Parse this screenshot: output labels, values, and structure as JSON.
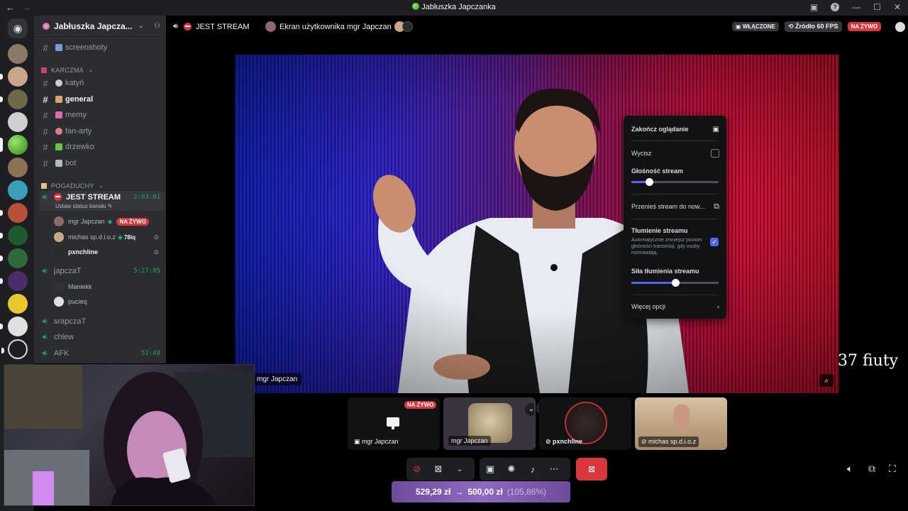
{
  "window": {
    "title": "Jabłuszka Japczanka"
  },
  "server": {
    "name": "Jabłuszka Japcza..."
  },
  "channels_top": [
    {
      "name": "screenshoty"
    }
  ],
  "categories": {
    "karczma": "KARCZMA",
    "pogaduchy": "POGADUCHY"
  },
  "channels_karczma": [
    {
      "name": "katyń"
    },
    {
      "name": "general"
    },
    {
      "name": "memy"
    },
    {
      "name": "fan-arty"
    },
    {
      "name": "drzewko"
    },
    {
      "name": "bot"
    }
  ],
  "voice": {
    "jest_stream": {
      "name": "JEST STREAM",
      "time": "2:03:01",
      "status": "Ustaw status kanału"
    },
    "jest_users": [
      {
        "name": "mgr Japczan",
        "badge": "NA ŻYWO"
      },
      {
        "name": "michas sp.d.i.o.z",
        "extra": "78lq"
      },
      {
        "name": "pxnchline"
      }
    ],
    "japczat": {
      "name": "japczaT",
      "time": "5:27:05"
    },
    "japczat_users": [
      {
        "name": "Maniekk"
      },
      {
        "name": "pucieq"
      }
    ],
    "srapczat": {
      "name": "srapczaT"
    },
    "chlew": {
      "name": "chlew"
    },
    "afk": {
      "name": "AFK",
      "time": "52:48"
    }
  },
  "topbar": {
    "channel": "JEST STREAM",
    "screen": "Ekran użytkownika mgr Japczan",
    "enabled": "WŁĄCZONE",
    "source": "Źródło 60 FPS",
    "live": "NA ŻYWO"
  },
  "stream": {
    "user": "mgr Japczan",
    "overlay": "37 fiuty"
  },
  "menu": {
    "end": "Zakończ oglądanie",
    "mute": "Wycisz",
    "volume_label": "Głośność stream",
    "volume": 0.2,
    "popout": "Przenieś stream do now...",
    "attenuation_label": "Tłumienie streamu",
    "attenuation_desc": "Automatycznie zmniejsz poziom głośności transmisji, gdy osoby rozmawiają.",
    "strength_label": "Siła tłumienia streamu",
    "strength": 0.5,
    "more": "Więcej opcji"
  },
  "tiles": [
    {
      "label": "mgr Japczan",
      "badge": "NA ŻYWO"
    },
    {
      "label": "mgr Japczan"
    },
    {
      "label": "pxnchline"
    },
    {
      "label": "michas sp.d.i.o.z"
    }
  ],
  "price": {
    "from": "529,29 zł",
    "arrow": "→",
    "to": "500,00 zł",
    "pct": "(105,86%)"
  },
  "colors": {
    "blurple": "#5865f2",
    "red": "#da373c",
    "green": "#23a55a"
  }
}
